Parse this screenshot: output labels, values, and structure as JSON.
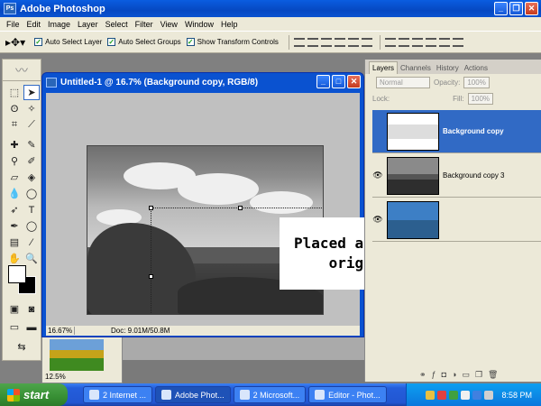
{
  "app": {
    "title": "Adobe Photoshop"
  },
  "menu": [
    "File",
    "Edit",
    "Image",
    "Layer",
    "Select",
    "Filter",
    "View",
    "Window",
    "Help"
  ],
  "options": {
    "auto_select_layer": "Auto Select Layer",
    "auto_select_groups": "Auto Select Groups",
    "show_transform_controls": "Show Transform Controls"
  },
  "document": {
    "title": "Untitled-1 @ 16.7% (Background copy, RGB/8)",
    "zoom": "16.67%",
    "doc_size": "Doc: 9.01M/50.8M"
  },
  "bg_window": {
    "zoom": "12.5%"
  },
  "caption": {
    "line1": "Placed and desaturated",
    "line2": "original image"
  },
  "layers_panel": {
    "tabs": [
      "Layers",
      "Channels",
      "History",
      "Actions"
    ],
    "blend_mode": "Normal",
    "opacity_label": "Opacity:",
    "opacity": "100%",
    "lock_label": "Lock:",
    "fill_label": "Fill:",
    "fill": "100%",
    "layers": [
      {
        "name": "Background copy",
        "selected": true
      },
      {
        "name": "Background copy 3",
        "selected": false
      },
      {
        "name": "",
        "selected": false
      }
    ]
  },
  "taskbar": {
    "start": "start",
    "tasks": [
      "2 Internet ...",
      "Adobe Phot...",
      "2 Microsoft...",
      "Editor - Phot..."
    ],
    "clock": "8:58 PM"
  }
}
